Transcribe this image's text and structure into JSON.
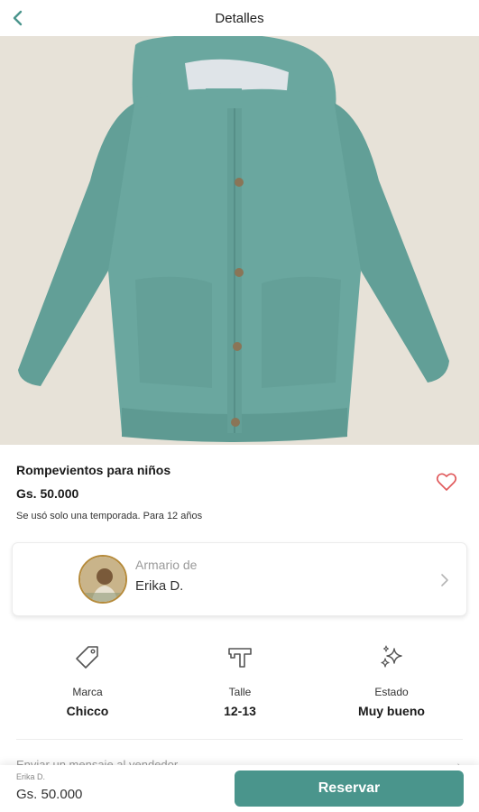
{
  "header": {
    "title": "Detalles",
    "back_icon": "chevron-left-icon"
  },
  "product": {
    "title": "Rompevientos para niños",
    "price": "Gs. 50.000",
    "description": "Se usó solo una temporada. Para 12 años",
    "favorite_icon": "heart-outline-icon"
  },
  "closet": {
    "label": "Armario de",
    "seller": "Erika D."
  },
  "attributes": [
    {
      "icon": "tag-icon",
      "label": "Marca",
      "value": "Chicco"
    },
    {
      "icon": "hanger-icon",
      "label": "Talle",
      "value": "12-13"
    },
    {
      "icon": "sparkle-icon",
      "label": "Estado",
      "value": "Muy bueno"
    }
  ],
  "message_row": {
    "text": "Enviar un mensaje al vendedor"
  },
  "bottom_bar": {
    "seller": "Erika D.",
    "price": "Gs. 50.000",
    "button": "Reservar"
  },
  "colors": {
    "accent": "#4a958c",
    "jacket": "#6aa79f",
    "heart": "#e0585a",
    "photo_bg": "#e7e2d8"
  }
}
